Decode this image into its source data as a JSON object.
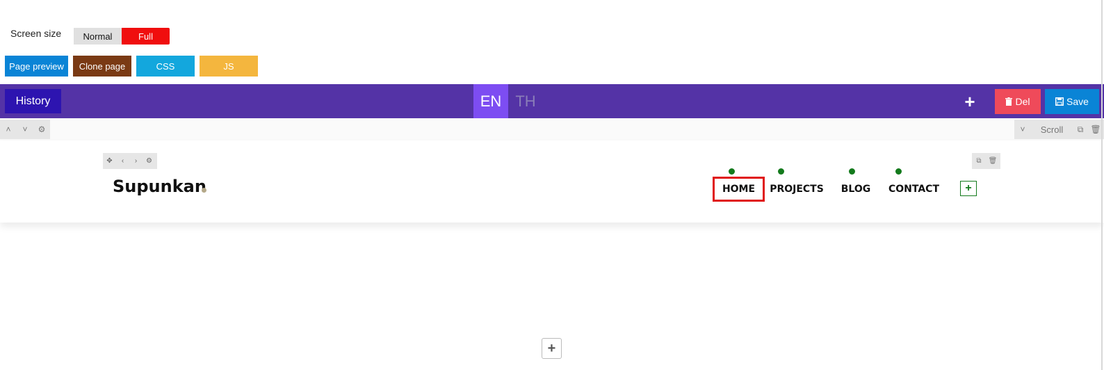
{
  "screen_size": {
    "label": "Screen size",
    "normal_label": "Normal",
    "full_label": "Full",
    "selected": "Full"
  },
  "actions": {
    "page_preview": "Page preview",
    "clone_page": "Clone page",
    "css": "CSS",
    "js": "JS"
  },
  "toolbar": {
    "history": "History",
    "languages": [
      "EN",
      "TH"
    ],
    "active_language": "EN",
    "plus_icon": "+",
    "del_label": "Del",
    "save_label": "Save"
  },
  "section_bar": {
    "up_icon": "˄",
    "down_icon": "˅",
    "settings_icon": "⚙",
    "collapse_icon": "˅",
    "scroll_label": "Scroll",
    "copy_icon": "⧉",
    "trash_icon": "🗑"
  },
  "header": {
    "controls": [
      "✥",
      "‹",
      "›",
      "⚙"
    ],
    "right_controls": [
      "⧉",
      "🗑"
    ],
    "logo_text": "Supunkan",
    "nav": [
      "HOME",
      "PROJECTS",
      "BLOG",
      "CONTACT"
    ],
    "active_nav": "HOME",
    "add_nav_icon": "+"
  },
  "add_section_icon": "+",
  "colors": {
    "toolbar_bg": "#5433a6",
    "history_bg": "#2d14b0",
    "lang_active_bg": "#7d4df2",
    "del_bg": "#ef4a5a",
    "save_bg": "#0a84d6",
    "full_bg": "#f00e0e",
    "clone_bg": "#7a3a14",
    "css_bg": "#13a7dd",
    "js_bg": "#f4b63e",
    "nav_dot": "#137a1c",
    "active_outline": "#e01515"
  }
}
